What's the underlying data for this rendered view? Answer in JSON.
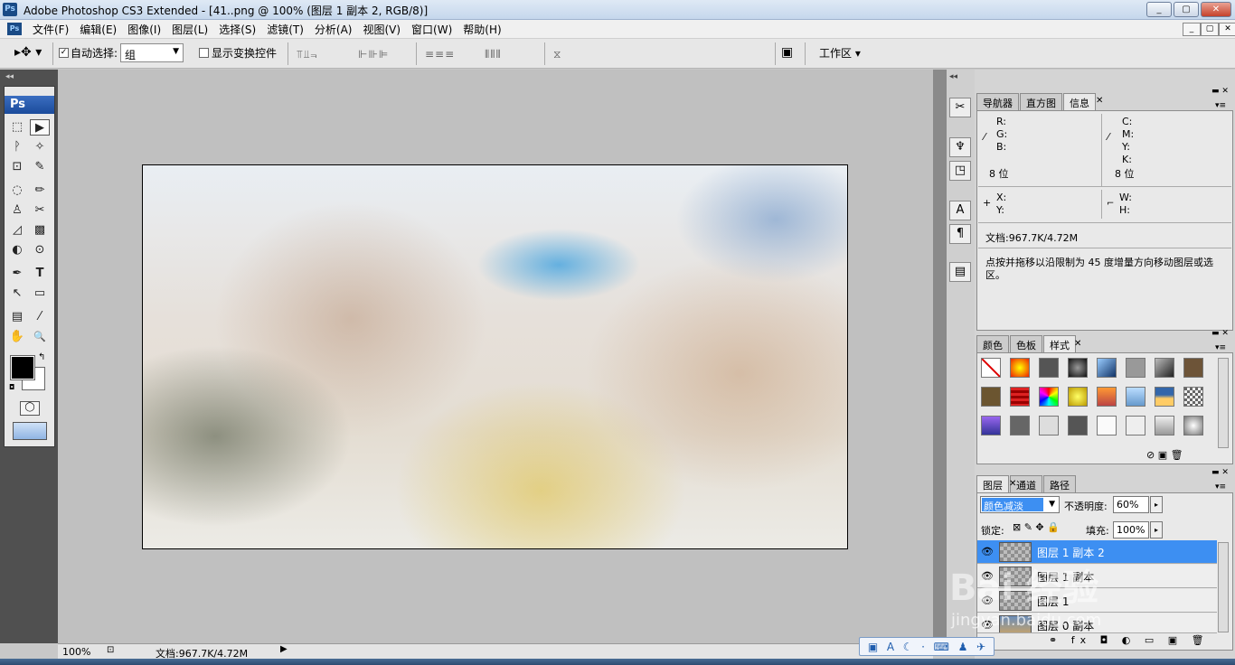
{
  "window": {
    "title": "Adobe Photoshop CS3 Extended - [41..png @ 100% (图层 1 副本 2, RGB/8)]",
    "icon": "Ps",
    "minimize": "_",
    "restore": "▢",
    "close": "✕"
  },
  "menubar": {
    "items": [
      "文件(F)",
      "编辑(E)",
      "图像(I)",
      "图层(L)",
      "选择(S)",
      "滤镜(T)",
      "分析(A)",
      "视图(V)",
      "窗口(W)",
      "帮助(H)"
    ],
    "doc_min": "_",
    "doc_restore": "▢",
    "doc_close": "✕"
  },
  "options": {
    "auto_select_label": "自动选择:",
    "auto_select_value": "组",
    "show_transform_label": "显示变换控件",
    "workspace_label": "工作区 ▾",
    "check_mark": "✓"
  },
  "toolbox": {
    "logo": "Ps",
    "tools": [
      "⬚",
      "▶",
      "ᚹ",
      "✧",
      "⊡",
      "✎",
      "◌",
      "✏",
      "♙",
      "✂",
      "◿",
      "▩",
      "◐",
      "⊙",
      "✒",
      "T",
      "↖",
      "▭",
      "▤",
      "⁄",
      "✋",
      "🔍"
    ]
  },
  "document": {
    "zoom": "100%",
    "doc_size": "文档:967.7K/4.72M"
  },
  "info_panel": {
    "tabs": [
      "导航器",
      "直方图",
      "信息"
    ],
    "r": "R:",
    "g": "G:",
    "b": "B:",
    "c": "C:",
    "m": "M:",
    "y": "Y:",
    "k": "K:",
    "bits_left": "8 位",
    "bits_right": "8 位",
    "x": "X:",
    "y2": "Y:",
    "w": "W:",
    "h": "H:",
    "doc": "文档:967.7K/4.72M",
    "hint": "点按并拖移以沿限制为 45 度增量方向移动图层或选区。"
  },
  "styles_panel": {
    "tabs": [
      "颜色",
      "色板",
      "样式"
    ]
  },
  "layers_panel": {
    "tabs": [
      "图层",
      "通道",
      "路径"
    ],
    "blend_mode": "颜色减淡",
    "opacity_label": "不透明度:",
    "opacity_value": "60%",
    "lock_label": "锁定:",
    "fill_label": "填充:",
    "fill_value": "100%",
    "layers": [
      {
        "name": "图层 1 副本 2",
        "selected": true
      },
      {
        "name": "图层 1 副本",
        "selected": false
      },
      {
        "name": "图层 1",
        "selected": false
      },
      {
        "name": "图层 0 副本",
        "selected": false
      }
    ]
  },
  "watermark": "Bai 经验",
  "watermark_sub": "jingyan.baidu.com",
  "colors": {
    "accent": "#3d8ff2",
    "toolbox_head": "#1b4b9b"
  }
}
